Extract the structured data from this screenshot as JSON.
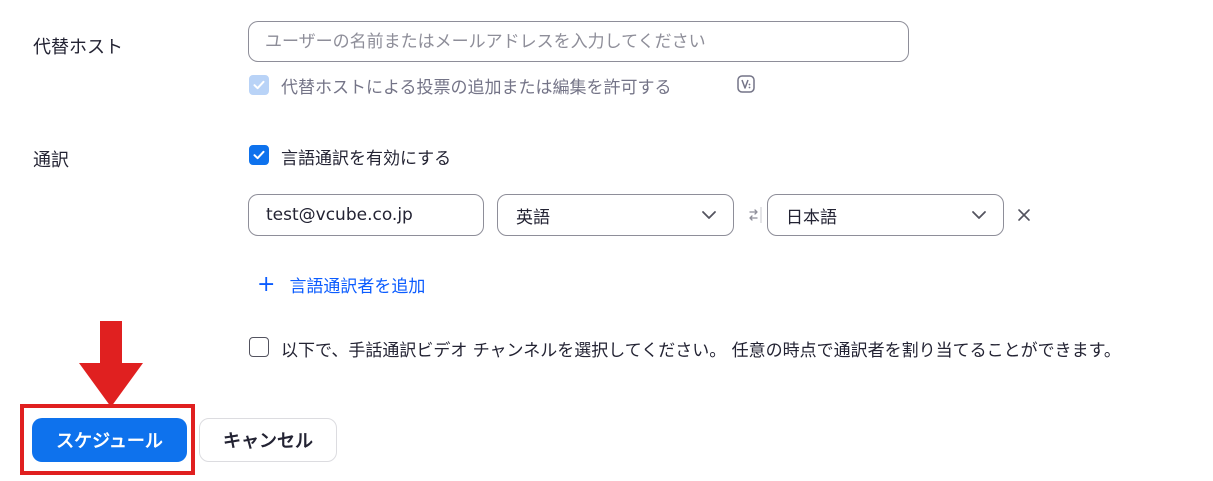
{
  "alt_host": {
    "label": "代替ホスト",
    "input_placeholder": "ユーザーの名前またはメールアドレスを入力してください",
    "poll_permission_label": "代替ホストによる投票の追加または編集を許可する",
    "poll_permission_checked": true
  },
  "interpretation": {
    "label": "通訳",
    "enable_label": "言語通訳を有効にする",
    "enabled": true,
    "interpreter": {
      "email": "test@vcube.co.jp",
      "from_language": "英語",
      "to_language": "日本語"
    },
    "add_interpreter_label": "言語通訳者を追加",
    "add_symbol": "+",
    "sign_language_label": "以下で、手話通訳ビデオ チャンネルを選択してください。 任意の時点で通訳者を割り当てることができます。",
    "sign_language_checked": false
  },
  "actions": {
    "schedule_label": "スケジュール",
    "cancel_label": "キャンセル"
  },
  "colors": {
    "accent": "#0e72ed",
    "annotation_red": "#e02020"
  }
}
